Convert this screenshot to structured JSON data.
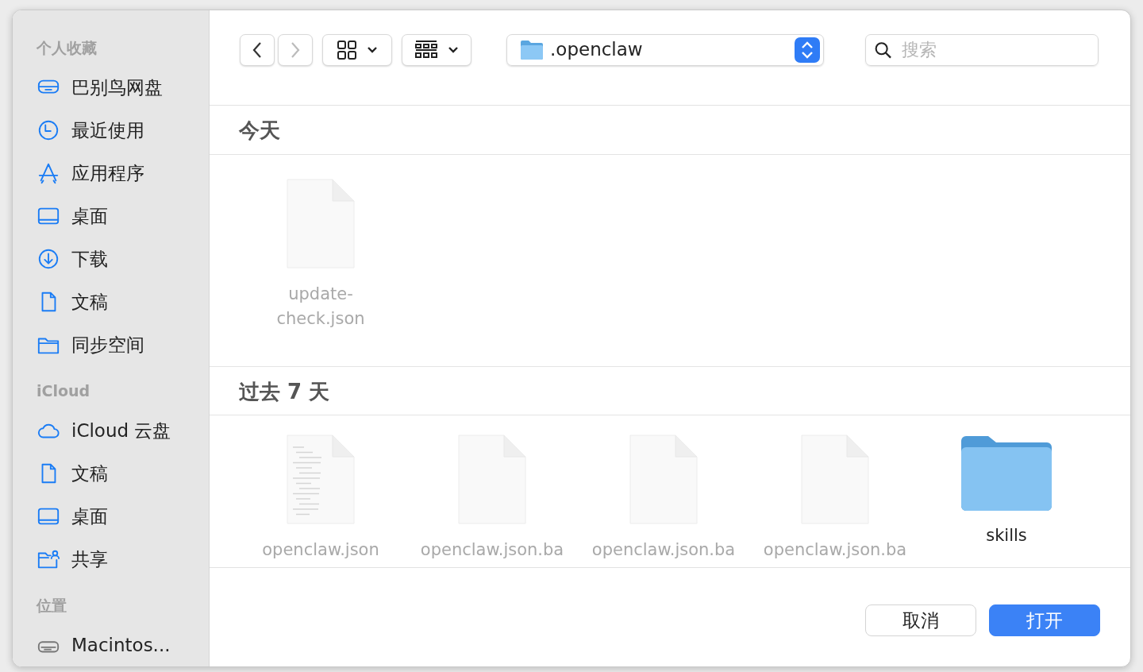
{
  "sidebar": [
    {
      "heading": "个人收藏",
      "items": [
        {
          "label": "巴别鸟网盘",
          "kind": "drive"
        },
        {
          "label": "最近使用",
          "kind": "clock"
        },
        {
          "label": "应用程序",
          "kind": "apps"
        },
        {
          "label": "桌面",
          "kind": "desktop"
        },
        {
          "label": "下载",
          "kind": "download"
        },
        {
          "label": "文稿",
          "kind": "document"
        },
        {
          "label": "同步空间",
          "kind": "folder"
        }
      ]
    },
    {
      "heading": "iCloud",
      "items": [
        {
          "label": "iCloud 云盘",
          "kind": "cloud"
        },
        {
          "label": "文稿",
          "kind": "document"
        },
        {
          "label": "桌面",
          "kind": "desktop"
        },
        {
          "label": "共享",
          "kind": "shared"
        }
      ]
    },
    {
      "heading": "位置",
      "items": [
        {
          "label": "Macintos...",
          "kind": "disk"
        }
      ]
    }
  ],
  "toolbar": {
    "back_enabled": true,
    "forward_enabled": false,
    "location": ".openclaw",
    "search": {
      "placeholder": "搜索"
    }
  },
  "sections": [
    {
      "title": "今天",
      "items": [
        {
          "name": "update-\ncheck.json",
          "kind": "file",
          "disabled": true
        }
      ]
    },
    {
      "title": "过去 7 天",
      "items": [
        {
          "name": "openclaw.json",
          "kind": "text-file",
          "disabled": true
        },
        {
          "name": "openclaw.json.ba",
          "kind": "file",
          "disabled": true
        },
        {
          "name": "openclaw.json.ba",
          "kind": "file",
          "disabled": true
        },
        {
          "name": "openclaw.json.ba",
          "kind": "file",
          "disabled": true
        },
        {
          "name": "skills",
          "kind": "folder",
          "disabled": false
        }
      ]
    }
  ],
  "buttons": [
    {
      "label": "取消",
      "primary": false
    },
    {
      "label": "打开",
      "primary": true
    }
  ]
}
